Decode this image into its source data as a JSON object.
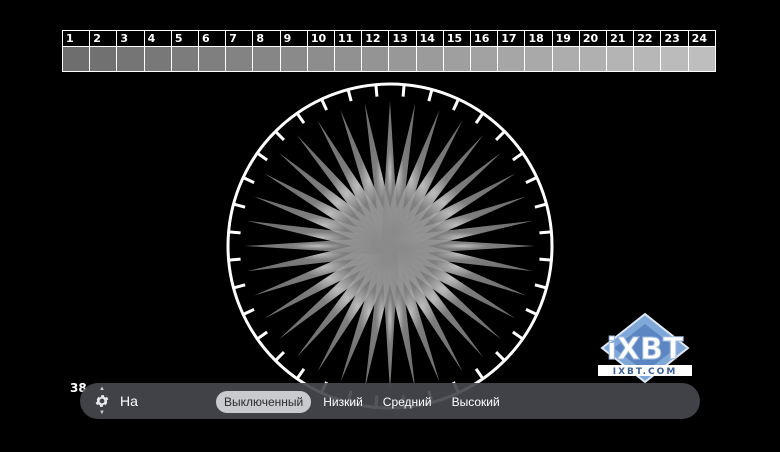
{
  "gray_scale": {
    "steps": [
      "1",
      "2",
      "3",
      "4",
      "5",
      "6",
      "7",
      "8",
      "9",
      "10",
      "11",
      "12",
      "13",
      "14",
      "15",
      "16",
      "17",
      "18",
      "19",
      "20",
      "21",
      "22",
      "23",
      "24"
    ]
  },
  "logo": {
    "main_text": "iXBT",
    "sub_text": "IXBT.COM"
  },
  "stray_text": "38",
  "settings": {
    "value": "На",
    "options": [
      "Выключенный",
      "Низкий",
      "Средний",
      "Высокий"
    ],
    "selected_index": 0
  },
  "colors": {
    "background": "#000000",
    "bar_background": "#46484e",
    "selected_pill": "#c9cacd",
    "logo_blue": "#7fa7d8"
  },
  "icons": {
    "settings": "gear-icon"
  }
}
